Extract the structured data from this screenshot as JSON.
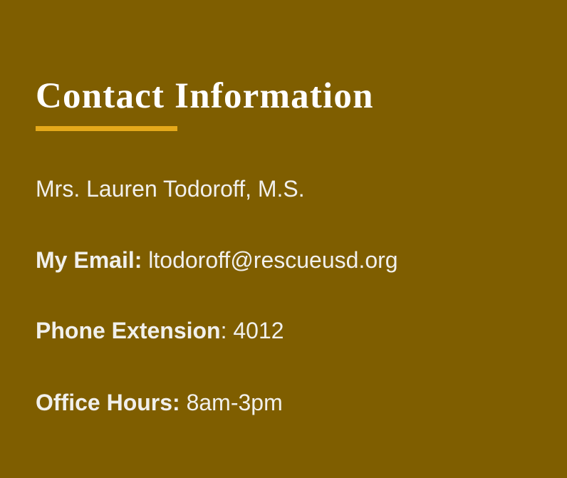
{
  "contact": {
    "title": "Contact Information",
    "name": "Mrs. Lauren Todoroff, M.S.",
    "email_label": "My Email:",
    "email_value": "ltodoroff@rescueusd.org",
    "phone_label": "Phone Extension",
    "phone_separator": ": ",
    "phone_value": "4012",
    "hours_label": "Office Hours:",
    "hours_value": "8am-3pm"
  },
  "colors": {
    "background": "#7f5e00",
    "accent": "#e5a91a",
    "text": "#f1f0ec"
  }
}
